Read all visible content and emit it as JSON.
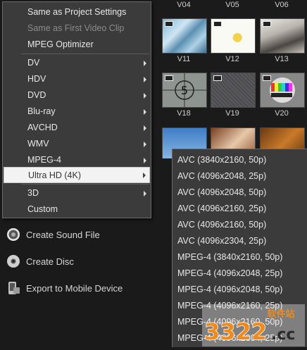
{
  "thumbnails": {
    "top_labels": [
      "V04",
      "V05",
      "V06"
    ],
    "row2_labels": [
      "V11",
      "V12",
      "V13"
    ],
    "row3_labels": [
      "V18",
      "V19",
      "V20"
    ]
  },
  "format_menu": {
    "items": [
      {
        "label": "Same as Project Settings",
        "disabled": false,
        "submenu": false
      },
      {
        "label": "Same as First Video Clip",
        "disabled": true,
        "submenu": false
      },
      {
        "label": "MPEG Optimizer",
        "disabled": false,
        "submenu": false
      },
      {
        "label": "DV",
        "disabled": false,
        "submenu": true
      },
      {
        "label": "HDV",
        "disabled": false,
        "submenu": true
      },
      {
        "label": "DVD",
        "disabled": false,
        "submenu": true
      },
      {
        "label": "Blu-ray",
        "disabled": false,
        "submenu": true
      },
      {
        "label": "AVCHD",
        "disabled": false,
        "submenu": true
      },
      {
        "label": "WMV",
        "disabled": false,
        "submenu": true
      },
      {
        "label": "MPEG-4",
        "disabled": false,
        "submenu": true
      },
      {
        "label": "Ultra HD (4K)",
        "disabled": false,
        "submenu": true,
        "highlighted": true
      },
      {
        "label": "3D",
        "disabled": false,
        "submenu": true
      },
      {
        "label": "Custom",
        "disabled": false,
        "submenu": false
      }
    ]
  },
  "ultra_hd_submenu": {
    "items": [
      "AVC (3840x2160, 50p)",
      "AVC (4096x2048, 25p)",
      "AVC (4096x2048, 50p)",
      "AVC (4096x2160, 25p)",
      "AVC (4096x2160, 50p)",
      "AVC (4096x2304, 25p)",
      "MPEG-4 (3840x2160, 50p)",
      "MPEG-4 (4096x2048, 25p)",
      "MPEG-4 (4096x2048, 50p)",
      "MPEG-4 (4096x2160, 25p)",
      "MPEG-4 (4096x2160, 50p)",
      "MPEG-4 (4096x2304, 25p)"
    ]
  },
  "left_panel": {
    "items": [
      {
        "label": "Create Sound File",
        "icon": "sound-file-icon"
      },
      {
        "label": "Create Disc",
        "icon": "disc-icon"
      },
      {
        "label": "Export to Mobile Device",
        "icon": "mobile-device-icon"
      }
    ]
  },
  "watermark": {
    "number": "3322",
    "suffix": ".cc",
    "chinese": "软件站"
  },
  "colors": {
    "menu_bg": "#3b3b3b",
    "menu_text": "#e8e8e8",
    "disabled_text": "#8c8c8c",
    "highlight_bg": "#f3f3f3",
    "watermark_orange": "#f08a1c"
  }
}
